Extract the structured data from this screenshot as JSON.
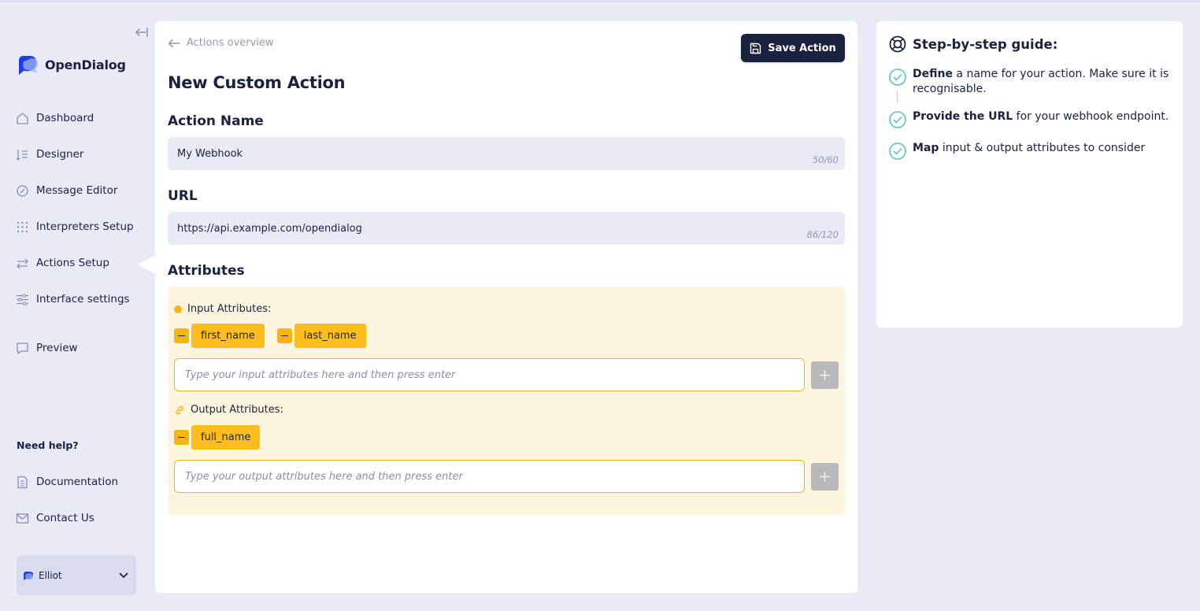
{
  "app": {
    "name": "OpenDialog"
  },
  "sidebar": {
    "nav": [
      {
        "label": "Dashboard",
        "icon": "home-icon"
      },
      {
        "label": "Designer",
        "icon": "designer-icon"
      },
      {
        "label": "Message Editor",
        "icon": "message-editor-icon"
      },
      {
        "label": "Interpreters Setup",
        "icon": "grid-dots-icon"
      },
      {
        "label": "Actions Setup",
        "icon": "arrows-exchange-icon",
        "active": true
      },
      {
        "label": "Interface settings",
        "icon": "sliders-icon"
      },
      {
        "label": "Preview",
        "icon": "chat-bubble-icon"
      }
    ],
    "help": {
      "title": "Need help?",
      "items": [
        {
          "label": "Documentation",
          "icon": "document-icon"
        },
        {
          "label": "Contact Us",
          "icon": "envelope-icon"
        }
      ]
    },
    "user": {
      "name": "Elliot"
    }
  },
  "main": {
    "back_label": "Actions overview",
    "save_label": "Save Action",
    "title": "New Custom Action",
    "action_name": {
      "label": "Action Name",
      "value": "My Webhook",
      "counter": "50/60"
    },
    "url": {
      "label": "URL",
      "value": "https://api.example.com/opendialog",
      "counter": "86/120"
    },
    "attributes": {
      "label": "Attributes",
      "input": {
        "heading": "Input Attributes:",
        "chips": [
          "first_name",
          "last_name"
        ],
        "placeholder": "Type your input attributes here and then press enter"
      },
      "output": {
        "heading": "Output Attributes:",
        "chips": [
          "full_name"
        ],
        "placeholder": "Type your output attributes here and then press enter"
      }
    }
  },
  "guide": {
    "title": "Step-by-step guide:",
    "steps": [
      {
        "bold": "Define",
        "text": " a name for your action. Make sure it is recognisable."
      },
      {
        "bold": "Provide the URL",
        "text": " for your webhook endpoint."
      },
      {
        "bold": "Map",
        "text": " input & output attributes to consider"
      }
    ]
  },
  "colors": {
    "navy": "#1b2240",
    "background": "#e8eaf6",
    "accent_yellow": "#fcbe1e",
    "attributes_bg": "#fdf5de",
    "check_teal": "#5ec4b6"
  }
}
